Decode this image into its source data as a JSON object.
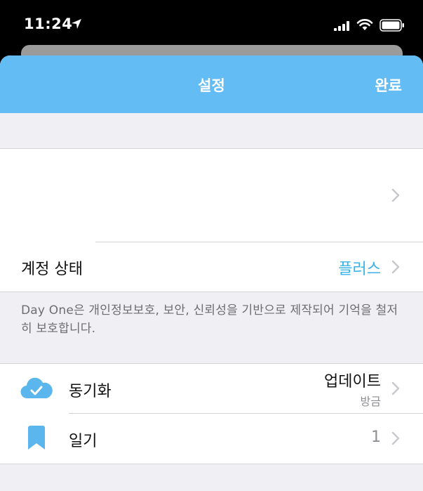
{
  "status_bar": {
    "time": "11:24",
    "icons": [
      "location-arrow-icon",
      "cellular-signal-icon",
      "wifi-icon",
      "battery-icon"
    ]
  },
  "nav": {
    "title": "설정",
    "done": "완료"
  },
  "account": {
    "label": "계정 상태",
    "value": "플러스"
  },
  "note": "Day One은 개인정보보호, 보안, 신뢰성을 기반으로 제작되어 기억을 철저히 보호합니다.",
  "sync": {
    "label": "동기화",
    "value": "업데이트",
    "subvalue": "방금",
    "icon": "cloud-check-icon"
  },
  "journals": {
    "label": "일기",
    "value": "1",
    "icon": "bookmark-icon"
  },
  "colors": {
    "nav": "#64bcf5",
    "accent": "#3ab4e8",
    "icon": "#5ab6ec"
  }
}
